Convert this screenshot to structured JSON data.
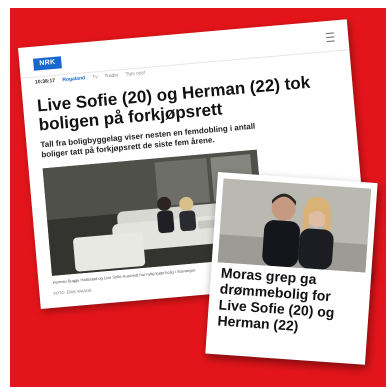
{
  "article": {
    "logo": "NRK",
    "nav": {
      "time": "10:38:17",
      "region": "Rogaland",
      "tv": "Tv",
      "radio": "Radio",
      "tegn": "Tips oss!"
    },
    "headline": "Live Sofie (20) og Herman (22) tok boligen på forkjøpsrett",
    "lede": "Tall fra boligbyggelag viser nesten en femdobling i antall boliger tatt på forkjøpsrett de siste fem årene.",
    "photo_caption": "Herman Bugge Hatlestad og Live Sofie Hustvedt har nylig kjøpt bolig i Stavanger.",
    "photo_credit": "FOTO: ERIK WAAGE"
  },
  "inset": {
    "headline": "Moras grep ga drømmebolig for Live Sofie (20) og Herman (22)"
  },
  "colors": {
    "background": "#e3151a",
    "nrk_blue": "#1767ce"
  },
  "icons": [
    "menu-icon"
  ]
}
